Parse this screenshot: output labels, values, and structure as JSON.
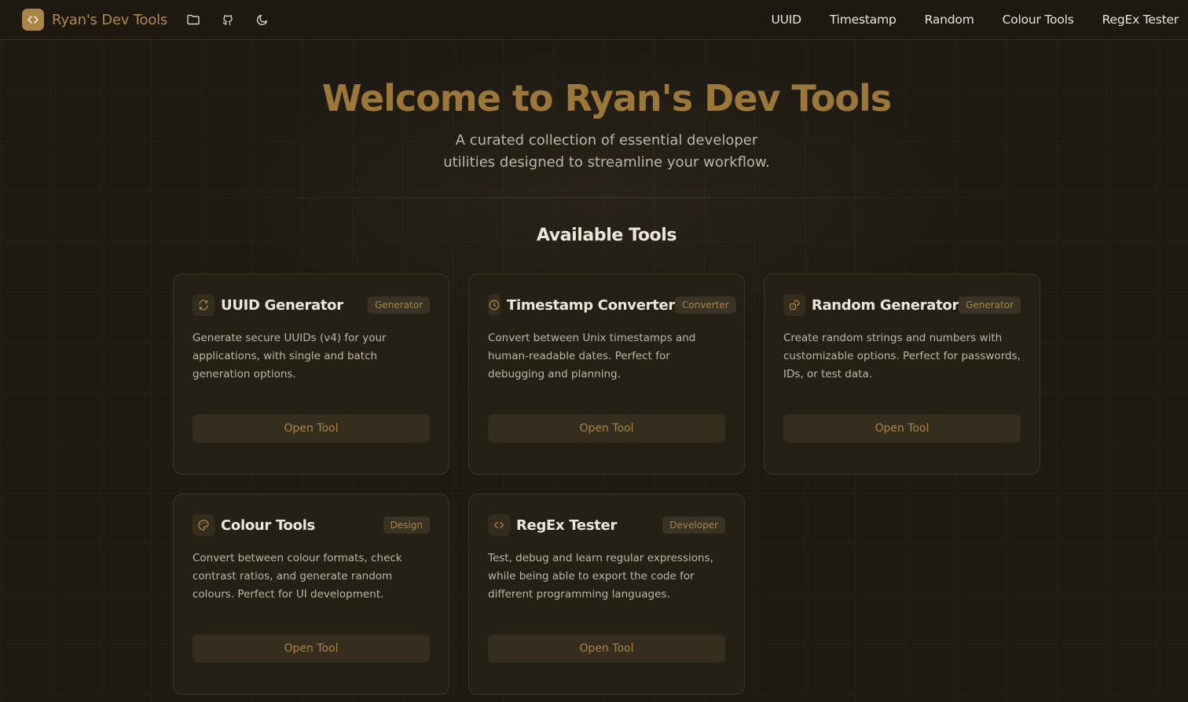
{
  "header": {
    "brand_name": "Ryan's Dev Tools",
    "nav": [
      "UUID",
      "Timestamp",
      "Random",
      "Colour Tools",
      "RegEx Tester"
    ]
  },
  "hero": {
    "title": "Welcome to Ryan's Dev Tools",
    "subtitle_line1": "A curated collection of essential developer",
    "subtitle_line2": "utilities designed to streamline your workflow."
  },
  "section_title": "Available Tools",
  "tools": [
    {
      "title": "UUID Generator",
      "badge": "Generator",
      "description": "Generate secure UUIDs (v4) for your applications, with single and batch generation options.",
      "button": "Open Tool",
      "icon": "refresh-icon"
    },
    {
      "title": "Timestamp Converter",
      "badge": "Converter",
      "description": "Convert between Unix timestamps and human-readable dates. Perfect for debugging and planning.",
      "button": "Open Tool",
      "icon": "clock-icon"
    },
    {
      "title": "Random Generator",
      "badge": "Generator",
      "description": "Create random strings and numbers with customizable options. Perfect for passwords, IDs, or test data.",
      "button": "Open Tool",
      "icon": "dice-icon"
    },
    {
      "title": "Colour Tools",
      "badge": "Design",
      "description": "Convert between colour formats, check contrast ratios, and generate random colours. Perfect for UI development.",
      "button": "Open Tool",
      "icon": "palette-icon"
    },
    {
      "title": "RegEx Tester",
      "badge": "Developer",
      "description": "Test, debug and learn regular expressions, while being able to export the code for different programming languages.",
      "button": "Open Tool",
      "icon": "code-icon"
    }
  ],
  "colors": {
    "accent": "#a88544",
    "background": "#1e1a12",
    "card": "#252015"
  }
}
